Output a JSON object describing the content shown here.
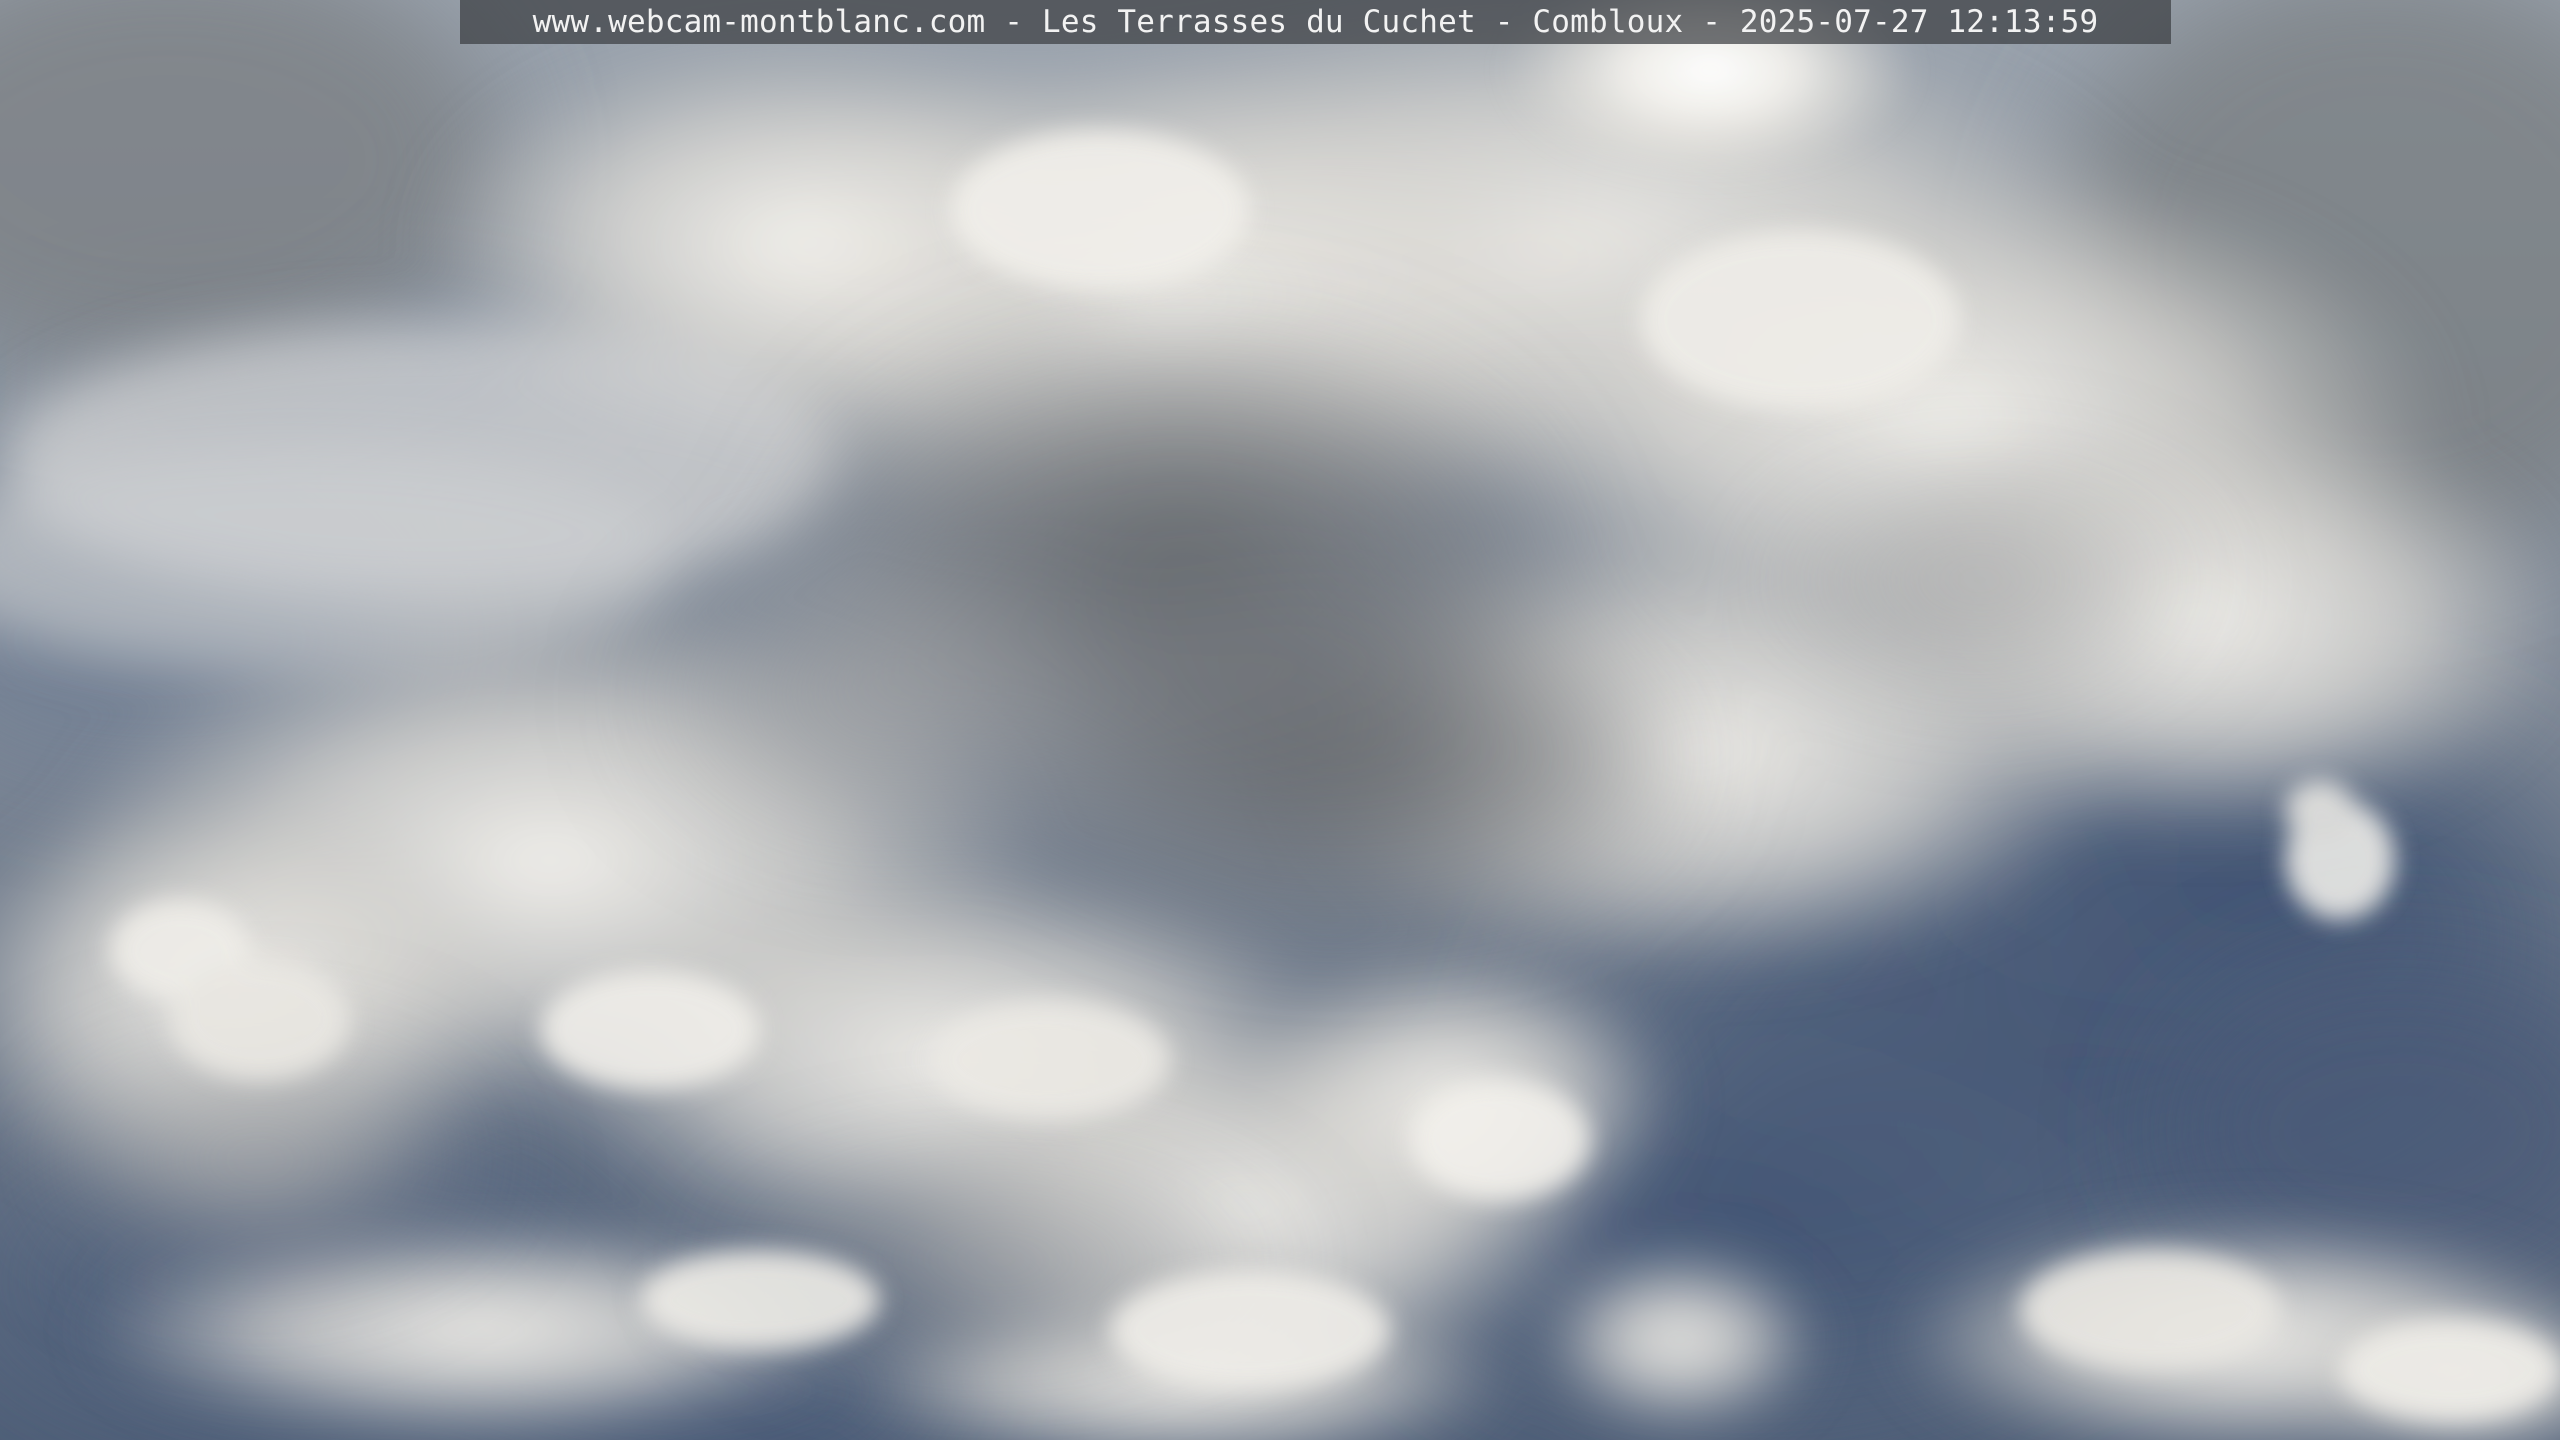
{
  "overlay": {
    "caption": "www.webcam-montblanc.com - Les Terrasses du Cuchet - Combloux - 2025-07-27 12:13:59"
  },
  "colors": {
    "sky_blue": "#4c5e7a",
    "cloud_white": "#f1eee8",
    "cloud_gray": "#8a8c90",
    "cloud_dark": "#606468"
  }
}
